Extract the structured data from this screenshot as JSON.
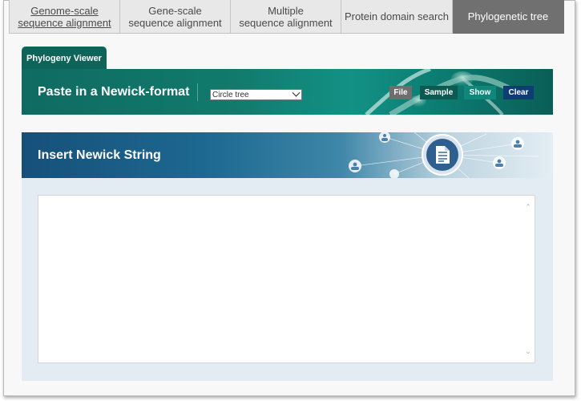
{
  "tabs": [
    {
      "label": "Genome-scale\nsequence alignment"
    },
    {
      "label": "Gene-scale\nsequence alignment"
    },
    {
      "label": "Multiple\nsequence alignment"
    },
    {
      "label": "Protein domain search"
    },
    {
      "label": "Phylogenetic tree"
    }
  ],
  "viewer": {
    "tab_label": "Phylogeny Viewer",
    "paste_title": "Paste in a Newick-format",
    "tree_type_selected": "Circle tree",
    "buttons": {
      "file": "File",
      "sample": "Sample",
      "show": "Show",
      "clear": "Clear"
    }
  },
  "insert": {
    "title": "Insert Newick String",
    "text_value": ""
  },
  "colors": {
    "active_tab": "#707070",
    "viewer_tab": "#0e6458",
    "clear_button": "#0d3d73",
    "show_button": "#11867a"
  }
}
